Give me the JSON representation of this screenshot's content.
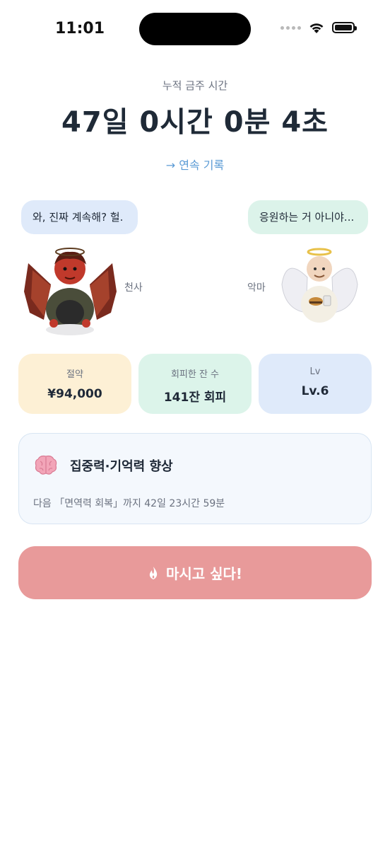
{
  "status_bar": {
    "time": "11:01"
  },
  "header": {
    "subtitle": "누적 금주 시간",
    "counter": "47일 0시간 0분 4초",
    "streak_link": "→ 연속 기록"
  },
  "characters": {
    "left": {
      "bubble": "와, 진짜 계속해? 헐.",
      "label": "천사",
      "icon": "devil-character"
    },
    "right": {
      "bubble": "응원하는 거 아니야...",
      "label": "악마",
      "icon": "angel-character"
    }
  },
  "stats": [
    {
      "title": "절약",
      "value": "¥94,000",
      "color": "#fdf0d5"
    },
    {
      "title": "회피한 잔 수",
      "value": "141잔 회피",
      "color": "#dcf4ea"
    },
    {
      "title": "Lv",
      "value": "Lv.6",
      "color": "#dfeafa"
    }
  ],
  "benefit": {
    "icon": "brain-icon",
    "title": "집중력·기억력 향상",
    "next": "다음 「면역력 회복」까지 42일 23시간 59분"
  },
  "cta": {
    "label": "마시고 싶다!",
    "icon": "flame-icon",
    "color": "#e89a9a"
  }
}
